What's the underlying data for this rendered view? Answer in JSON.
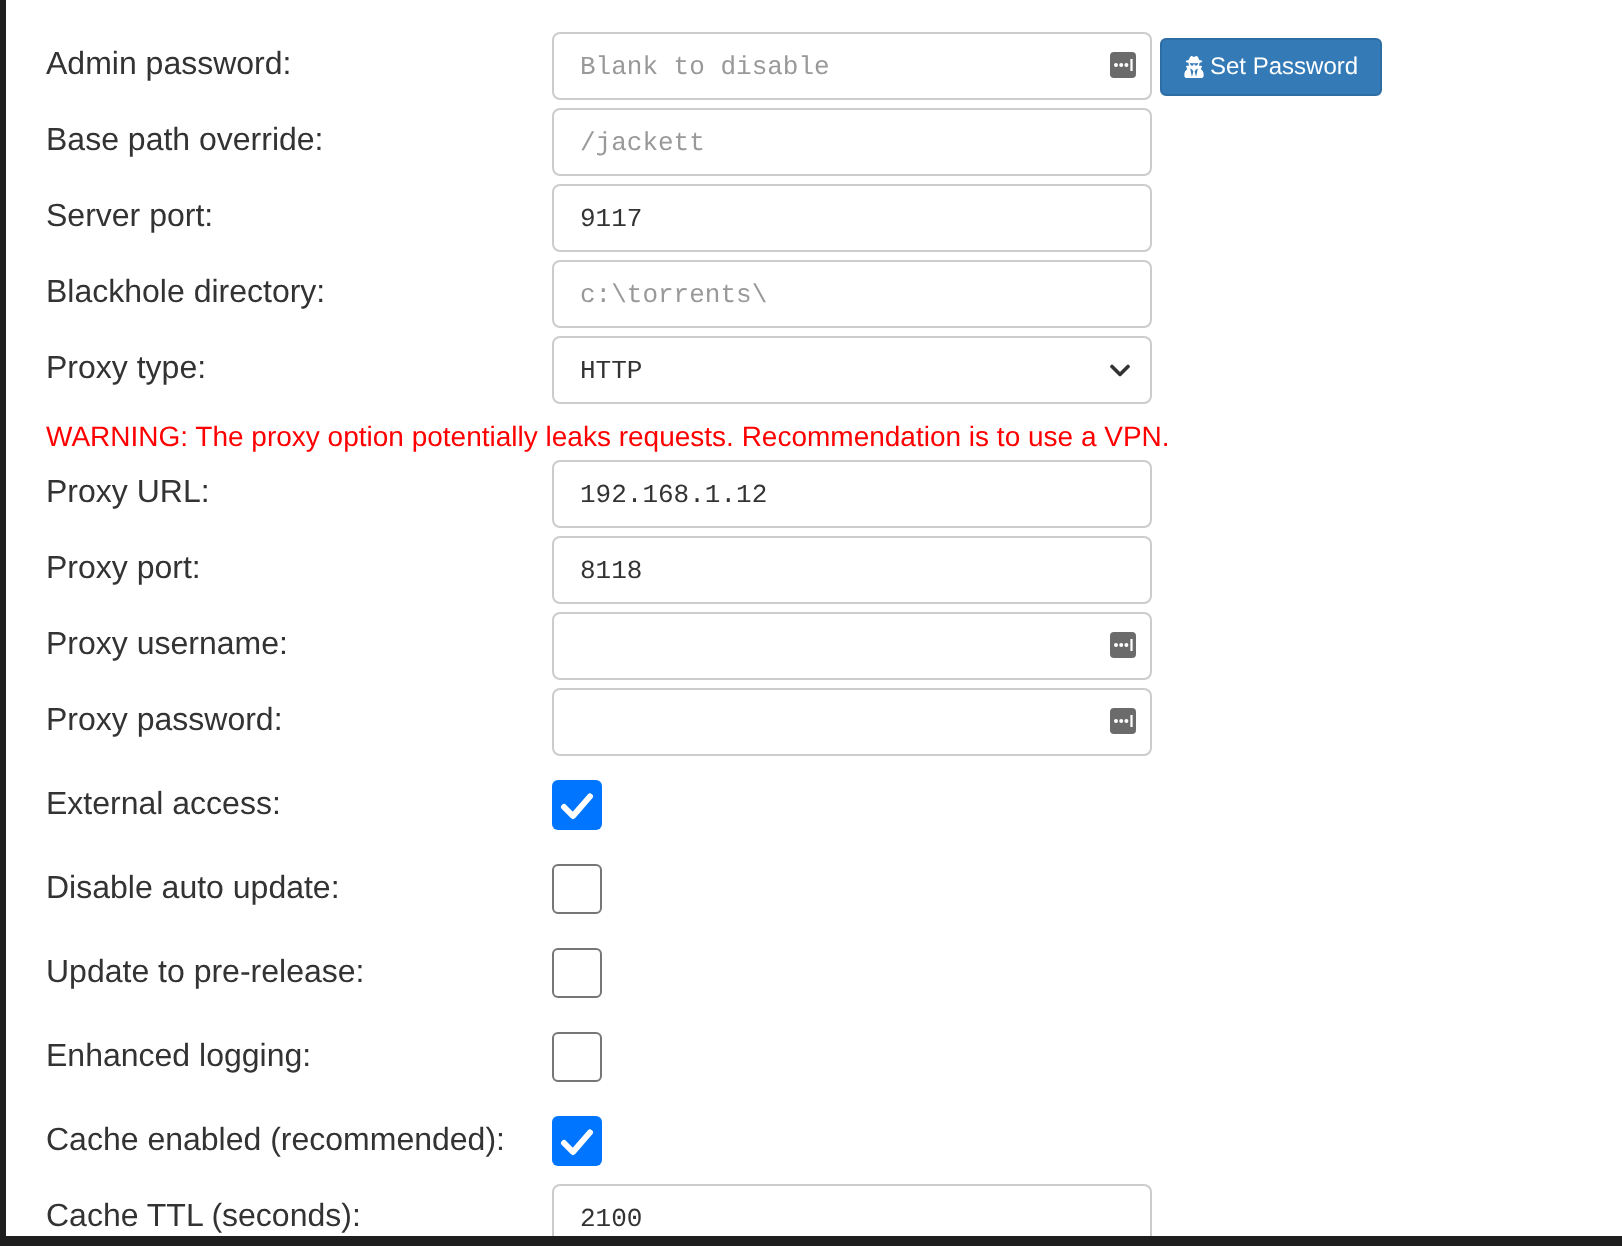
{
  "settings": [
    {
      "kind": "password",
      "label": "Admin password:",
      "placeholder": "Blank to disable",
      "button": "Set Password"
    },
    {
      "kind": "text",
      "label": "Base path override:",
      "placeholder": "/jackett"
    },
    {
      "kind": "text",
      "label": "Server port:",
      "value": "9117"
    },
    {
      "kind": "text",
      "label": "Blackhole directory:",
      "placeholder": "c:\\torrents\\"
    },
    {
      "kind": "select",
      "label": "Proxy type:",
      "value": "HTTP"
    },
    {
      "kind": "warning",
      "text": "WARNING: The proxy option potentially leaks requests. Recommendation is to use a VPN."
    },
    {
      "kind": "text",
      "label": "Proxy URL:",
      "value": "192.168.1.12"
    },
    {
      "kind": "text",
      "label": "Proxy port:",
      "value": "8118"
    },
    {
      "kind": "password",
      "label": "Proxy username:"
    },
    {
      "kind": "password",
      "label": "Proxy password:"
    },
    {
      "kind": "checkbox",
      "label": "External access:",
      "checked": true
    },
    {
      "kind": "checkbox",
      "label": "Disable auto update:",
      "checked": false
    },
    {
      "kind": "checkbox",
      "label": "Update to pre-release:",
      "checked": false
    },
    {
      "kind": "checkbox",
      "label": "Enhanced logging:",
      "checked": false
    },
    {
      "kind": "checkbox",
      "label": "Cache enabled (recommended):",
      "checked": true
    },
    {
      "kind": "text",
      "label": "Cache TTL (seconds):",
      "value": "2100"
    }
  ]
}
